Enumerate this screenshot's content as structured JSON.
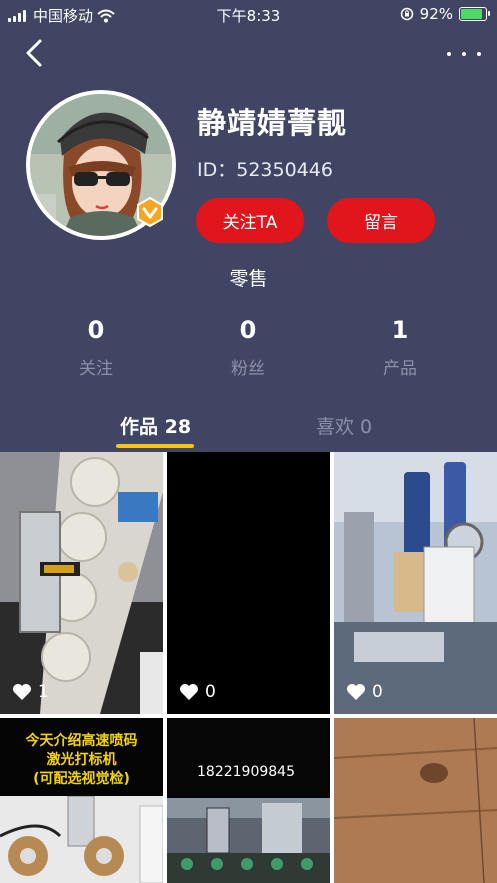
{
  "status_bar": {
    "carrier": "中国移动",
    "time": "下午8:33",
    "battery_percent": "92%",
    "battery_level": 0.92
  },
  "nav": {
    "back_icon": "chevron-left-icon",
    "more_icon": "more-horizontal-icon"
  },
  "profile": {
    "name": "静靖婧菁靓",
    "id_text": "ID：52350446",
    "follow_button": "关注TA",
    "message_button": "留言",
    "tagline": "零售"
  },
  "stats": [
    {
      "value": "0",
      "label": "关注"
    },
    {
      "value": "0",
      "label": "粉丝"
    },
    {
      "value": "1",
      "label": "产品"
    }
  ],
  "tabs": {
    "works": "作品 28",
    "likes": "喜欢 0"
  },
  "grid": {
    "tiles": [
      {
        "likes": "1"
      },
      {
        "likes": "0"
      },
      {
        "likes": "0"
      }
    ],
    "tile4_caption": [
      "今天介绍高速喷码",
      "激光打标机",
      "(可配选视觉检)"
    ],
    "tile5_phone": "18221909845"
  },
  "colors": {
    "background": "#3f4563",
    "accent_red": "#e0161c",
    "tab_underline": "#f5c518"
  }
}
